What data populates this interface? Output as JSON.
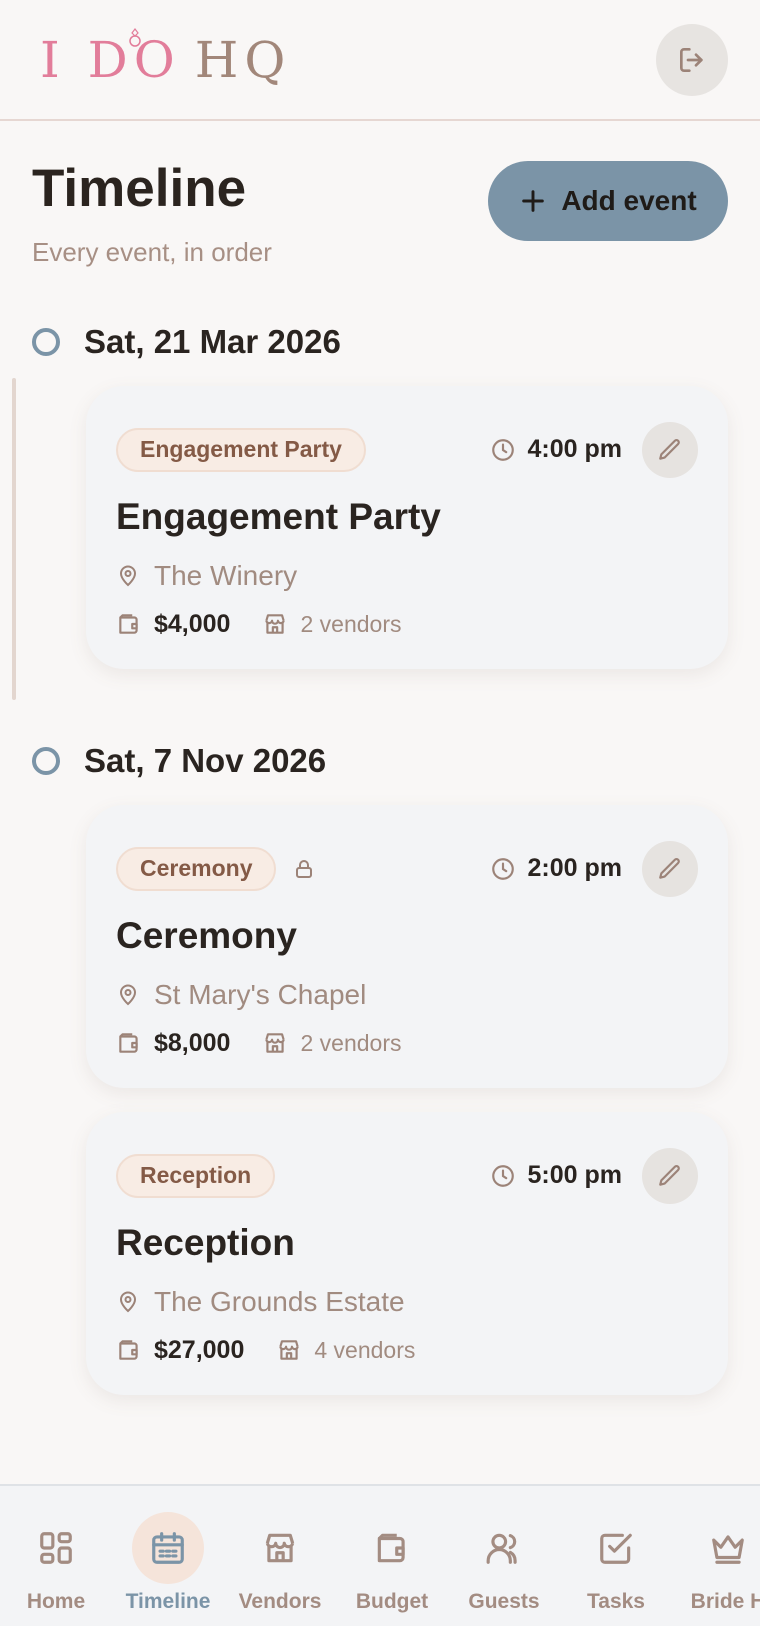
{
  "app": {
    "logo_part1": "I DO",
    "logo_part2": "HQ"
  },
  "colors": {
    "accent": "#7b94a7",
    "logo_pink": "#e27d9a",
    "badge_bg": "#f8ece4",
    "muted_text": "#a18b80"
  },
  "page": {
    "title": "Timeline",
    "subtitle": "Every event, in order",
    "add_label": "Add event"
  },
  "groups": [
    {
      "date": "Sat, 21 Mar 2026",
      "events": [
        {
          "category": "Engagement Party",
          "locked": false,
          "time": "4:00 pm",
          "title": "Engagement Party",
          "location": "The Winery",
          "budget": "$4,000",
          "vendors": "2 vendors"
        }
      ]
    },
    {
      "date": "Sat, 7 Nov 2026",
      "events": [
        {
          "category": "Ceremony",
          "locked": true,
          "time": "2:00 pm",
          "title": "Ceremony",
          "location": "St Mary's Chapel",
          "budget": "$8,000",
          "vendors": "2 vendors"
        },
        {
          "category": "Reception",
          "locked": false,
          "time": "5:00 pm",
          "title": "Reception",
          "location": "The Grounds Estate",
          "budget": "$27,000",
          "vendors": "4 vendors"
        }
      ]
    }
  ],
  "nav": [
    {
      "label": "Home",
      "icon": "grid-icon",
      "active": false
    },
    {
      "label": "Timeline",
      "icon": "calendar-icon",
      "active": true
    },
    {
      "label": "Vendors",
      "icon": "store-icon",
      "active": false
    },
    {
      "label": "Budget",
      "icon": "wallet-icon",
      "active": false
    },
    {
      "label": "Guests",
      "icon": "users-icon",
      "active": false
    },
    {
      "label": "Tasks",
      "icon": "checkbox-icon",
      "active": false
    },
    {
      "label": "Bride H",
      "icon": "crown-icon",
      "active": false
    }
  ]
}
